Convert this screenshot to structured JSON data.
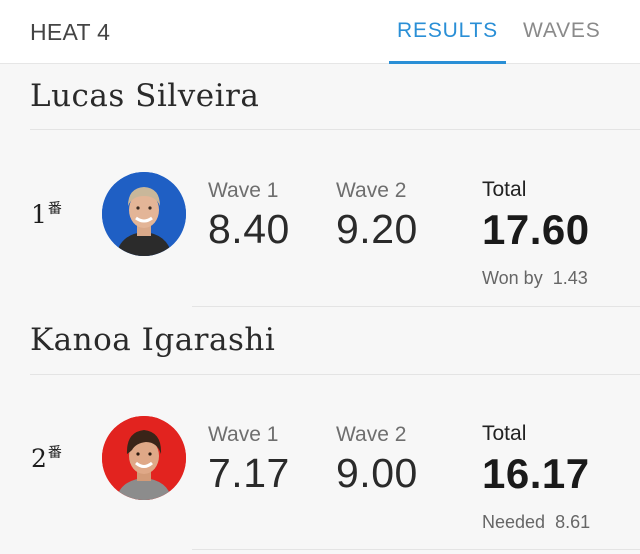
{
  "header": {
    "title": "HEAT 4",
    "tabs": [
      {
        "label": "RESULTS",
        "active": true
      },
      {
        "label": "WAVES",
        "active": false
      }
    ],
    "accent_color": "#2a8fd6"
  },
  "surfers": [
    {
      "name": "Lucas Silveira",
      "place": "1",
      "place_suffix": "番",
      "avatar_bg": "#1f5fc4",
      "wave1_label": "Wave 1",
      "wave1": "8.40",
      "wave2_label": "Wave 2",
      "wave2": "9.20",
      "total_label": "Total",
      "total": "17.60",
      "note_label": "Won by",
      "note_value": "1.43"
    },
    {
      "name": "Kanoa Igarashi",
      "place": "2",
      "place_suffix": "番",
      "avatar_bg": "#e2231f",
      "wave1_label": "Wave 1",
      "wave1": "7.17",
      "wave2_label": "Wave 2",
      "wave2": "9.00",
      "total_label": "Total",
      "total": "16.17",
      "note_label": "Needed",
      "note_value": "8.61"
    }
  ]
}
